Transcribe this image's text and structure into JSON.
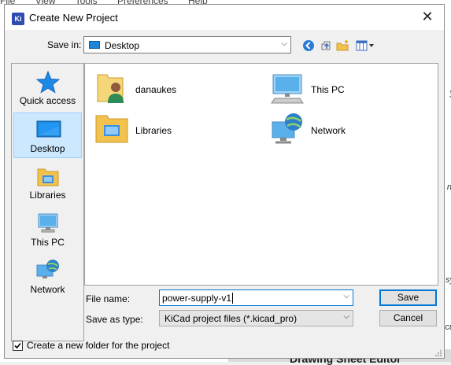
{
  "background": {
    "menu": [
      "File",
      "View",
      "Tools",
      "Preferences",
      "Help"
    ],
    "side_texts": [
      "y",
      "nt",
      "sy",
      "cu"
    ],
    "bottom_text": "Drawing Sheet Editor"
  },
  "dialog": {
    "app_icon_text": "Ki",
    "title": "Create New Project",
    "close_icon": "close-icon"
  },
  "toolbar": {
    "save_in_label": "Save in:",
    "save_in_value": "Desktop",
    "icons": [
      "back-icon",
      "up-folder-icon",
      "new-folder-icon",
      "view-menu-icon"
    ]
  },
  "places": [
    {
      "label": "Quick access",
      "icon": "star-icon"
    },
    {
      "label": "Desktop",
      "icon": "desktop-icon",
      "selected": true
    },
    {
      "label": "Libraries",
      "icon": "libraries-icon"
    },
    {
      "label": "This PC",
      "icon": "computer-icon"
    },
    {
      "label": "Network",
      "icon": "network-icon"
    }
  ],
  "files": [
    {
      "label": "danaukes",
      "icon": "user-folder-icon"
    },
    {
      "label": "This PC",
      "icon": "computer-icon"
    },
    {
      "label": "Libraries",
      "icon": "libraries-icon"
    },
    {
      "label": "Network",
      "icon": "network-icon"
    }
  ],
  "form": {
    "file_name_label": "File name:",
    "file_name_value": "power-supply-v1",
    "save_as_type_label": "Save as type:",
    "save_as_type_value": "KiCad project files (*.kicad_pro)",
    "save_button": "Save",
    "cancel_button": "Cancel",
    "new_folder_checkbox_label": "Create a new folder for the project",
    "new_folder_checked": true
  },
  "colors": {
    "accent": "#0078d7",
    "selection_bg": "#cce8ff",
    "kicad_icon": "#314cb0"
  }
}
